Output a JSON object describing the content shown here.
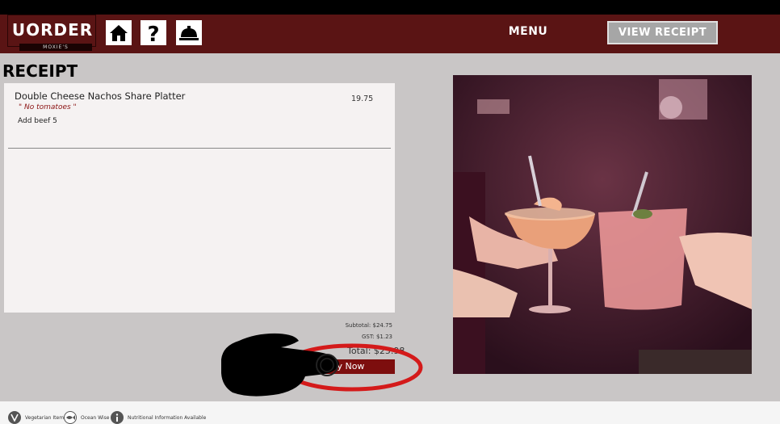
{
  "header": {
    "brand": "UORDER",
    "brand_sub": "MOXIE'S",
    "menu_label": "MENU",
    "view_receipt_label": "VIEW RECEIPT",
    "icons": [
      "home-icon",
      "help-icon",
      "service-bell-icon"
    ]
  },
  "receipt": {
    "title": "RECEIPT",
    "items": [
      {
        "name": "Double Cheese Nachos Share Platter",
        "price": "19.75",
        "note": "\" No tomatoes \"",
        "addon": "Add beef 5"
      }
    ],
    "subtotal": "Subtotal: $24.75",
    "gst": "GST: $1.23",
    "total": "Total: $25.98",
    "pay_now_label": "Pay Now"
  },
  "footer": {
    "legend": [
      {
        "icon": "vegetarian-icon",
        "label": "Vegetarian Item"
      },
      {
        "icon": "ocean-wise-icon",
        "label": "Ocean Wise"
      },
      {
        "icon": "info-icon",
        "label": "Nutritional Information Available"
      }
    ]
  },
  "colors": {
    "header_bg": "#5a1414",
    "page_bg": "#c9c6c6",
    "pay_button": "#7d0e0e",
    "note_text": "#8a1010"
  }
}
